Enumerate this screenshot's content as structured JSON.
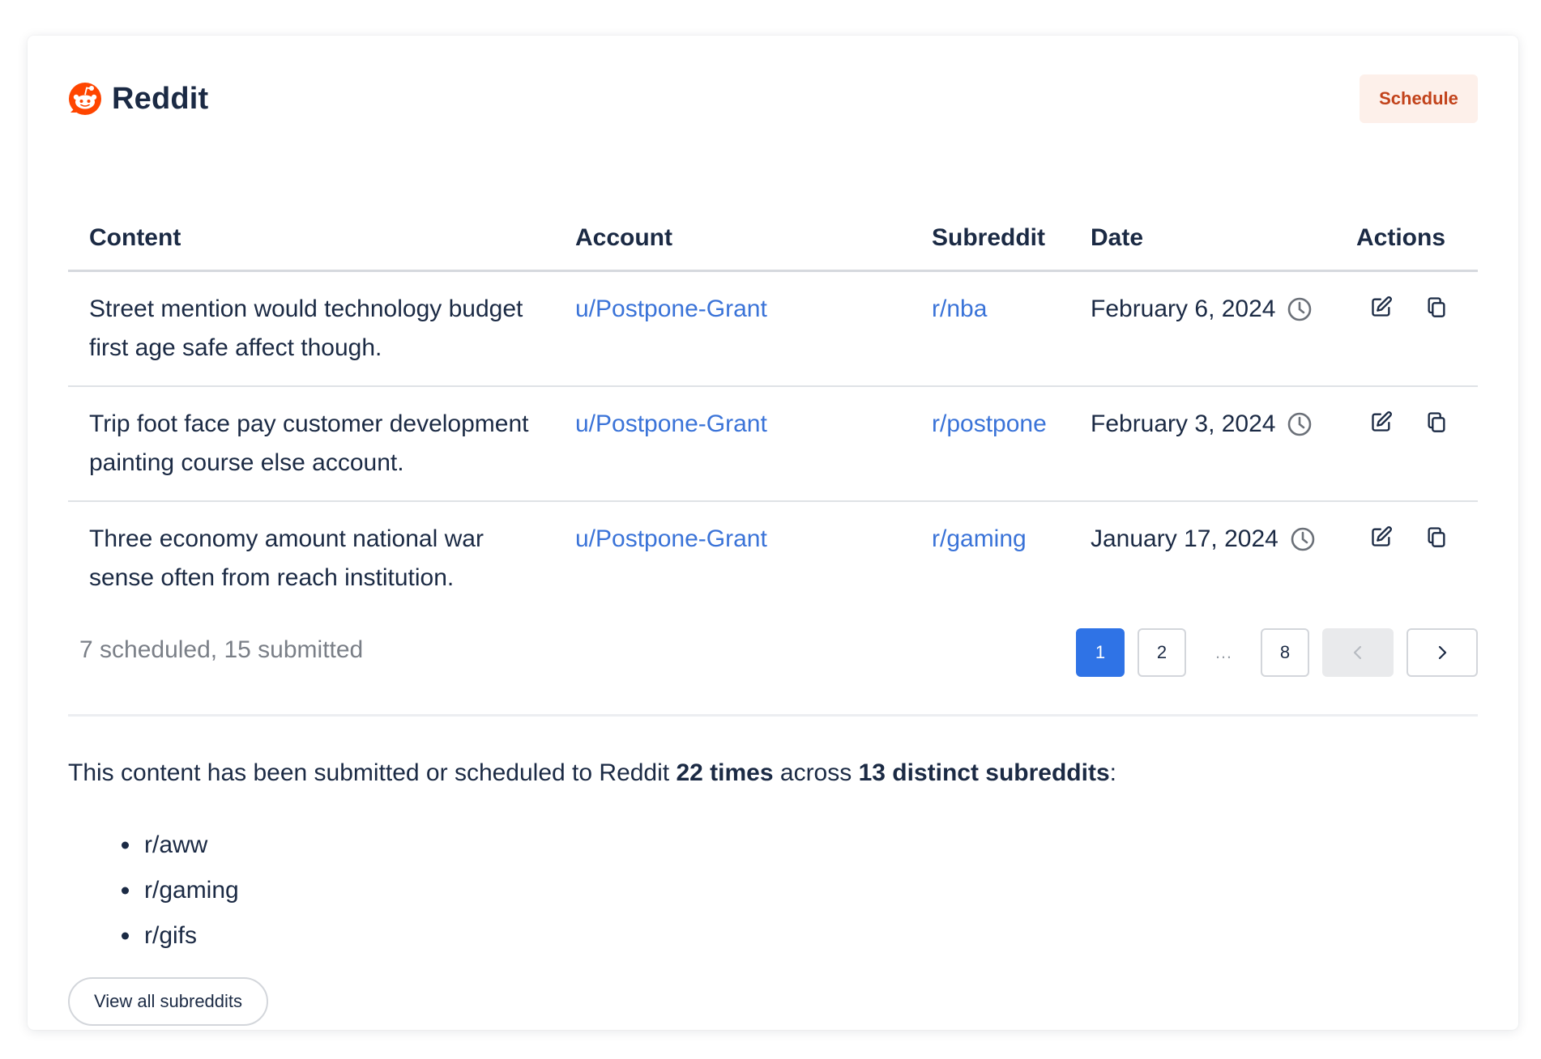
{
  "header": {
    "title": "Reddit",
    "schedule_label": "Schedule",
    "brand_color": "#ff4500"
  },
  "table": {
    "columns": [
      "Content",
      "Account",
      "Subreddit",
      "Date",
      "Actions"
    ],
    "rows": [
      {
        "content": "Street mention would technology budget first age safe affect though.",
        "account": "u/Postpone-Grant",
        "subreddit": "r/nba",
        "date": "February 6, 2024"
      },
      {
        "content": "Trip foot face pay customer development painting course else account.",
        "account": "u/Postpone-Grant",
        "subreddit": "r/postpone",
        "date": "February 3, 2024"
      },
      {
        "content": "Three economy amount national war sense often from reach institution.",
        "account": "u/Postpone-Grant",
        "subreddit": "r/gaming",
        "date": "January 17, 2024"
      }
    ],
    "row_icons": [
      "clock-icon",
      "edit-icon",
      "copy-icon"
    ]
  },
  "summary": {
    "counts": "7 scheduled, 15 submitted"
  },
  "pagination": {
    "pages": [
      "1",
      "2",
      "8"
    ],
    "ellipsis": "…",
    "current": "1",
    "active_color": "#2f73e6"
  },
  "stats": {
    "prefix": "This content has been submitted or scheduled to Reddit ",
    "times": "22 times",
    "middle": " across ",
    "distinct": "13 distinct subreddits",
    "suffix": ":"
  },
  "subreddits": [
    "r/aww",
    "r/gaming",
    "r/gifs"
  ],
  "view_all_label": "View all subreddits",
  "colors": {
    "link": "#3a73d8",
    "text": "#1b2a44",
    "muted": "#7a7f87"
  }
}
